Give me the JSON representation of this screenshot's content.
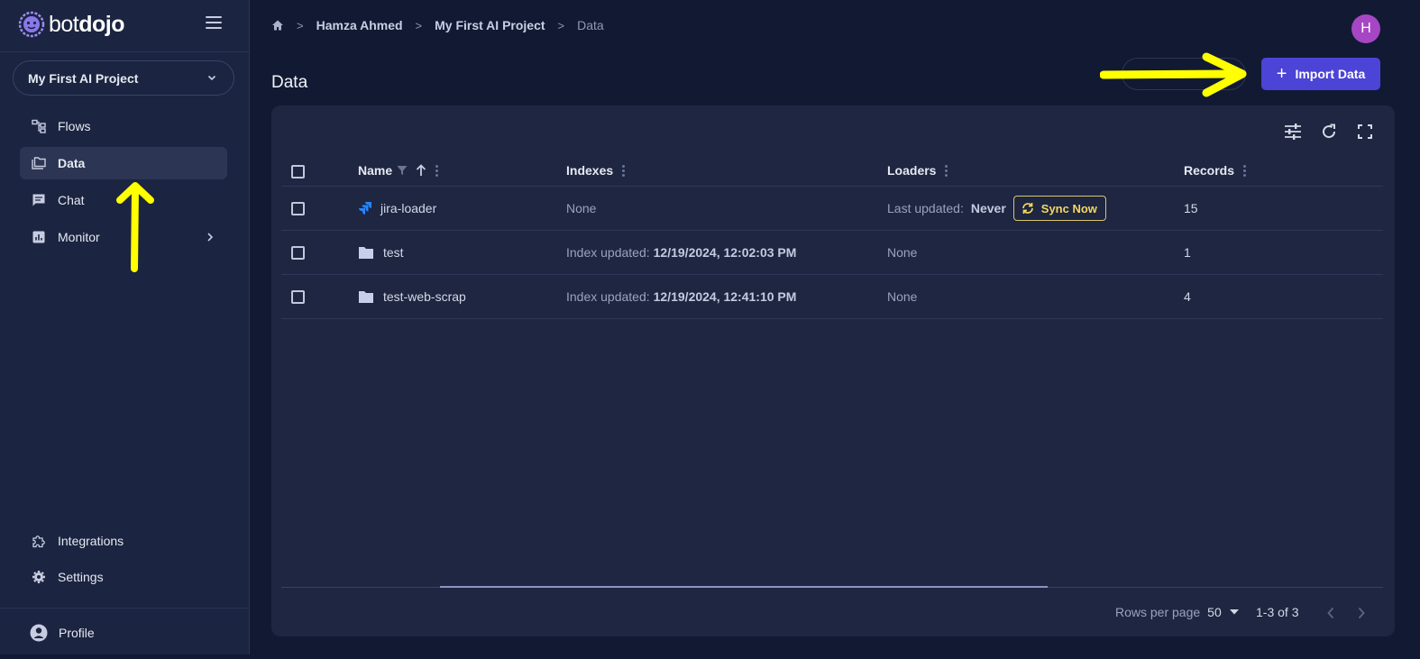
{
  "brand": {
    "name_light": "bot",
    "name_bold": "dojo"
  },
  "project_selector": {
    "label": "My First AI Project"
  },
  "sidebar": {
    "items": [
      {
        "label": "Flows"
      },
      {
        "label": "Data"
      },
      {
        "label": "Chat"
      },
      {
        "label": "Monitor"
      }
    ],
    "bottom_items": [
      {
        "label": "Integrations"
      },
      {
        "label": "Settings"
      },
      {
        "label": "Profile"
      }
    ]
  },
  "breadcrumb": [
    "Hamza Ahmed",
    "My First AI Project",
    "Data"
  ],
  "avatar": {
    "initial": "H"
  },
  "page": {
    "title": "Data"
  },
  "actions": {
    "import_label": "Import Data"
  },
  "table": {
    "columns": [
      "Name",
      "Indexes",
      "Loaders",
      "Records"
    ],
    "rows": [
      {
        "name": "jira-loader",
        "icon": "jira-icon",
        "index_text": "None",
        "loader_prefix": "Last updated:",
        "loader_value": "Never",
        "sync_label": "Sync Now",
        "records": "15"
      },
      {
        "name": "test",
        "icon": "folder-icon",
        "index_prefix": "Index updated:",
        "index_value": "12/19/2024, 12:02:03 PM",
        "loader_text": "None",
        "records": "1"
      },
      {
        "name": "test-web-scrap",
        "icon": "folder-icon",
        "index_prefix": "Index updated:",
        "index_value": "12/19/2024, 12:41:10 PM",
        "loader_text": "None",
        "records": "4"
      }
    ]
  },
  "pagination": {
    "rows_per_page_label": "Rows per page",
    "rows_per_page_value": "50",
    "range": "1-3 of 3"
  },
  "colors": {
    "accent": "#4b44d6",
    "annotation": "#ffff00",
    "sync": "#f2d860",
    "avatar": "#a646c4"
  }
}
